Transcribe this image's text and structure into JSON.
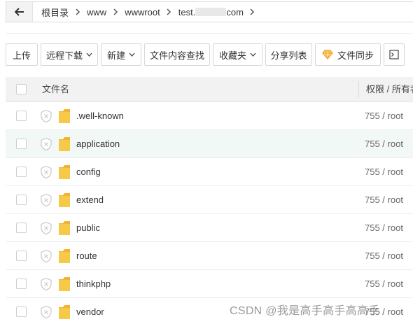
{
  "breadcrumb": {
    "items": [
      "根目录",
      "www",
      "wwwroot",
      "test."
    ],
    "last_suffix": "com"
  },
  "toolbar": {
    "upload": "上传",
    "remote_download": "远程下载",
    "new": "新建",
    "search_content": "文件内容查找",
    "favorites": "收藏夹",
    "share_list": "分享列表",
    "file_sync": "文件同步"
  },
  "table": {
    "headers": {
      "name": "文件名",
      "perm": "权限 / 所有者"
    },
    "rows": [
      {
        "name": ".well-known",
        "perm": "755 / root"
      },
      {
        "name": "application",
        "perm": "755 / root"
      },
      {
        "name": "config",
        "perm": "755 / root"
      },
      {
        "name": "extend",
        "perm": "755 / root"
      },
      {
        "name": "public",
        "perm": "755 / root"
      },
      {
        "name": "route",
        "perm": "755 / root"
      },
      {
        "name": "thinkphp",
        "perm": "755 / root"
      },
      {
        "name": "vendor",
        "perm": "755 / root"
      }
    ]
  },
  "watermark": "CSDN @我是高手高手高高手",
  "colors": {
    "folder": "#f5c242",
    "highlight_row": "#f1f8f6",
    "gem": "#f0a020"
  }
}
